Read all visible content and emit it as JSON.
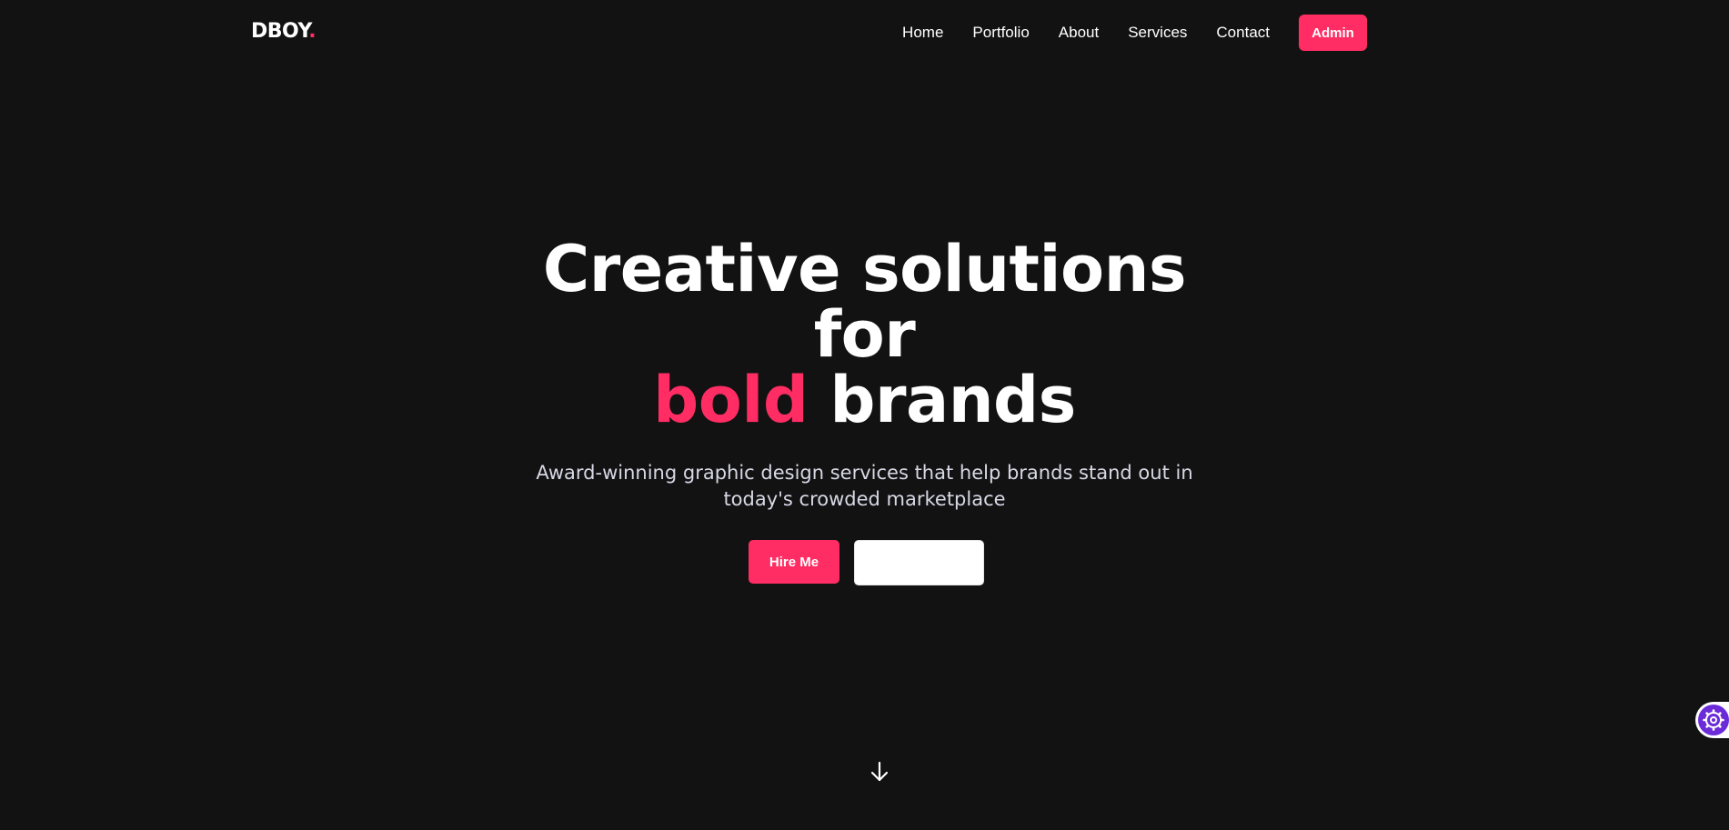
{
  "brand": {
    "name": "DBOY",
    "dot": ".",
    "accent_color": "#ff2d63"
  },
  "nav": {
    "links": [
      "Home",
      "Portfolio",
      "About",
      "Services",
      "Contact"
    ],
    "admin_label": "Admin"
  },
  "hero": {
    "title_line1": "Creative solutions",
    "title_line2": "for",
    "title_accent": "bold",
    "title_rest": "brands",
    "subtitle": "Award-winning graphic design services that help brands stand out in today's crowded marketplace",
    "primary_cta": "Hire Me",
    "secondary_cta": ""
  },
  "icons": {
    "scroll": "arrow-down-icon",
    "settings": "gear-icon"
  },
  "colors": {
    "background": "#121212",
    "accent": "#ff2d63",
    "widget": "#6c2bd9"
  }
}
